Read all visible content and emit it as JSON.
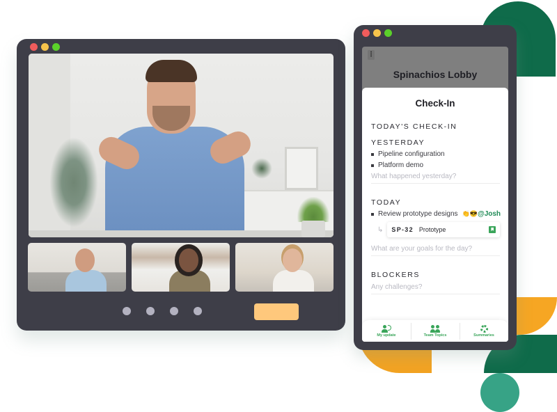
{
  "colors": {
    "window_frame": "#3e3e48",
    "accent_green": "#3aa55a",
    "brand_dark_green": "#0f6b4a",
    "brand_orange": "#f6a623",
    "brand_teal": "#37a386",
    "action_button": "#fec87c",
    "placeholder_text": "#b9b9c2"
  },
  "video_call": {
    "main_participant": "Presenter video feed",
    "thumbnails": [
      "Participant 1",
      "Participant 2",
      "Participant 3"
    ],
    "pager_dots": 4,
    "action_button_label": ""
  },
  "phone": {
    "menu_icon": "kebab-menu-icon",
    "lobby_title": "Spinachios Lobby",
    "sheet_title": "Check-In",
    "section_title": "TODAY'S CHECK-IN",
    "yesterday": {
      "label": "YESTERDAY",
      "items": [
        "Pipeline configuration",
        "Platform demo"
      ],
      "placeholder": "What happened yesterday?"
    },
    "today": {
      "label": "TODAY",
      "item_text": "Review prototype designs",
      "item_emojis": "👏😎",
      "mention": "@Josh",
      "ticket": {
        "id": "SP-32",
        "title": "Prototype",
        "icon": "bookmark-icon"
      },
      "placeholder": "What are your goals for the day?"
    },
    "blockers": {
      "label": "BLOCKERS",
      "placeholder": "Any challenges?"
    },
    "tabs": [
      {
        "label": "My update",
        "icon": "person-speaking-icon"
      },
      {
        "label": "Team Topics",
        "icon": "team-icon"
      },
      {
        "label": "Summaries",
        "icon": "summary-ring-icon"
      }
    ]
  }
}
